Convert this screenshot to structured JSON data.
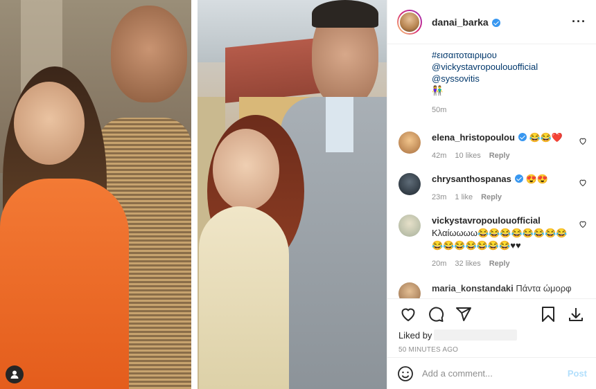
{
  "post": {
    "author": "danai_barka",
    "caption_lines": [
      "#εισαιτοταιριμου",
      "@vickystavropoulouofficial",
      "@syssovitis"
    ],
    "caption_emoji": "👫",
    "caption_time": "50m"
  },
  "comments": [
    {
      "user": "elena_hristopoulou",
      "verified": true,
      "text": "😂😂❤️",
      "time": "42m",
      "likes": "10 likes",
      "reply": "Reply",
      "avatar_color": "#d9b28a"
    },
    {
      "user": "chrysanthospanas",
      "verified": true,
      "text": "😍😍",
      "time": "23m",
      "likes": "1 like",
      "reply": "Reply",
      "avatar_color": "#2e3a46"
    },
    {
      "user": "vickystavropoulouofficial",
      "verified": false,
      "text": "Κλαίωωωω😂😂😂😂😂😂😂😂😂😂😂😂😂😂😂♥♥",
      "time": "20m",
      "likes": "32 likes",
      "reply": "Reply",
      "avatar_color": "#c8c2a8"
    },
    {
      "user": "maria_konstandaki",
      "verified": false,
      "text": "Πάντα ώμορφ",
      "time": "",
      "likes": "",
      "reply": "",
      "avatar_color": "#b88a5a"
    }
  ],
  "actions": {
    "like_icon": "heart-outline-icon",
    "comment_icon": "speech-bubble-icon",
    "share_icon": "paper-plane-icon",
    "save_icon": "bookmark-icon",
    "download_icon": "download-icon",
    "liked_by": "Liked by",
    "timestamp": "50 MINUTES AGO"
  },
  "add_comment": {
    "placeholder": "Add a comment...",
    "post_label": "Post"
  },
  "colors": {
    "link": "#00376b",
    "verified": "#3897f0",
    "post_disabled": "#b2dffc",
    "meta": "#8e8e8e"
  }
}
